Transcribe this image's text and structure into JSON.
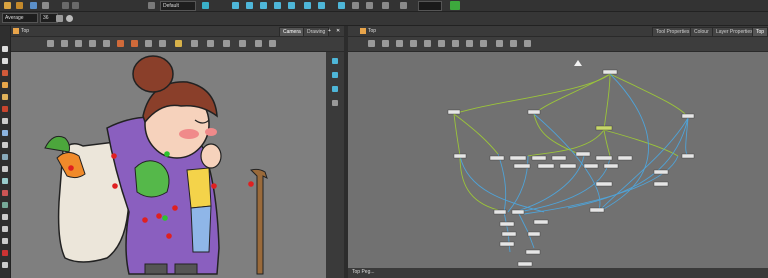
{
  "toolbar": {
    "preset": "Default",
    "brush_mode": "Average",
    "brush_size": "36"
  },
  "camera_view": {
    "breadcrumb": "Top",
    "tabs": [
      {
        "label": "Camera",
        "active": true
      },
      {
        "label": "Drawing",
        "active": false
      }
    ]
  },
  "node_view": {
    "breadcrumb": "Top",
    "tabs": [
      {
        "label": "Tool Properties",
        "active": false
      },
      {
        "label": "Colour",
        "active": false
      },
      {
        "label": "Layer Properties",
        "active": false
      },
      {
        "label": "Top",
        "active": true
      }
    ],
    "footer": "Top  Peg..."
  },
  "colors": {
    "stage_bg": "#7f7f7f",
    "node_bg": "#717171",
    "green_wire": "#9bc43a",
    "blue_wire": "#4fa3d8",
    "pivot_red": "#e02020",
    "pivot_green": "#2ec22e"
  }
}
